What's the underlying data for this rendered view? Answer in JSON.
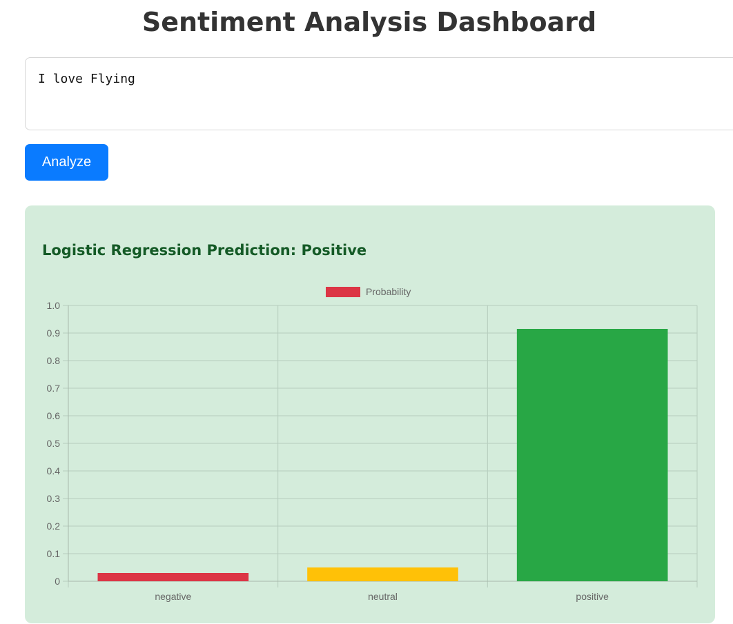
{
  "header": {
    "title": "Sentiment Analysis Dashboard"
  },
  "input": {
    "value": "I love Flying"
  },
  "analyze_button": {
    "label": "Analyze",
    "color": "#0a7bff"
  },
  "result": {
    "prediction_text": "Logistic Regression Prediction: Positive",
    "panel_color": "#d4ecdb",
    "text_color": "#145a26"
  },
  "chart_data": {
    "type": "bar",
    "categories": [
      "negative",
      "neutral",
      "positive"
    ],
    "series": [
      {
        "name": "Probability",
        "values": [
          0.03,
          0.05,
          0.915
        ],
        "colors": [
          "#dc3545",
          "#ffc107",
          "#28a745"
        ]
      }
    ],
    "legend_color": "#dc3545",
    "legend_position": "top-center",
    "ylim": [
      0,
      1.0
    ],
    "yticks": [
      "0",
      "0.1",
      "0.2",
      "0.3",
      "0.4",
      "0.5",
      "0.6",
      "0.7",
      "0.8",
      "0.9",
      "1.0"
    ],
    "grid": true,
    "title": "",
    "xlabel": "",
    "ylabel": ""
  }
}
